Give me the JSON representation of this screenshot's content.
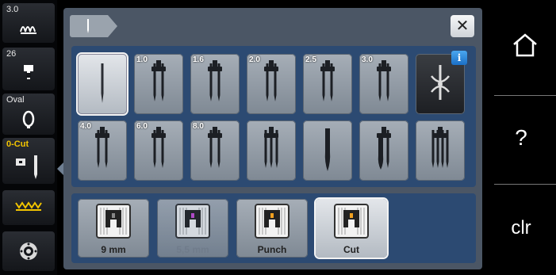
{
  "left_sidebar": {
    "items": [
      {
        "id": "stitch-length",
        "small": "3.0",
        "icon": "stitch-icon"
      },
      {
        "id": "hoop-count",
        "small": "26",
        "icon": "presser-foot-icon"
      },
      {
        "id": "hoop",
        "small": "Oval",
        "icon": "oval-hoop-icon"
      },
      {
        "id": "cut",
        "small": "0-Cut",
        "icon": "needle-foot-icon"
      },
      {
        "id": "feed-dog",
        "small": "",
        "icon": "zigzag-icon"
      },
      {
        "id": "bobbin",
        "small": "",
        "icon": "bobbin-icon"
      }
    ]
  },
  "header": {
    "close_label": "✕",
    "tab_icon": "needle-icon"
  },
  "needles": [
    {
      "label": "",
      "type": "single",
      "selected": true
    },
    {
      "label": "1.0",
      "type": "double"
    },
    {
      "label": "1.6",
      "type": "double"
    },
    {
      "label": "2.0",
      "type": "double"
    },
    {
      "label": "2.5",
      "type": "double"
    },
    {
      "label": "3.0",
      "type": "double"
    },
    {
      "label": "",
      "type": "info",
      "info": "i"
    },
    {
      "label": "4.0",
      "type": "double"
    },
    {
      "label": "6.0",
      "type": "double"
    },
    {
      "label": "8.0",
      "type": "double"
    },
    {
      "label": "",
      "type": "triple"
    },
    {
      "label": "",
      "type": "wing"
    },
    {
      "label": "",
      "type": "wing-double"
    },
    {
      "label": "",
      "type": "quad"
    }
  ],
  "feet": [
    {
      "label": "9 mm",
      "dim": false,
      "selected": false,
      "accent": "#888888"
    },
    {
      "label": "5,5 mm",
      "dim": true,
      "selected": false,
      "accent": "#c64ad6"
    },
    {
      "label": "Punch",
      "dim": false,
      "selected": false,
      "accent": "#f0a020"
    },
    {
      "label": "Cut",
      "dim": false,
      "selected": true,
      "accent": "#f0a020"
    }
  ],
  "right_sidebar": {
    "home_icon": "home-icon",
    "help_label": "?",
    "clear_label": "clr"
  }
}
